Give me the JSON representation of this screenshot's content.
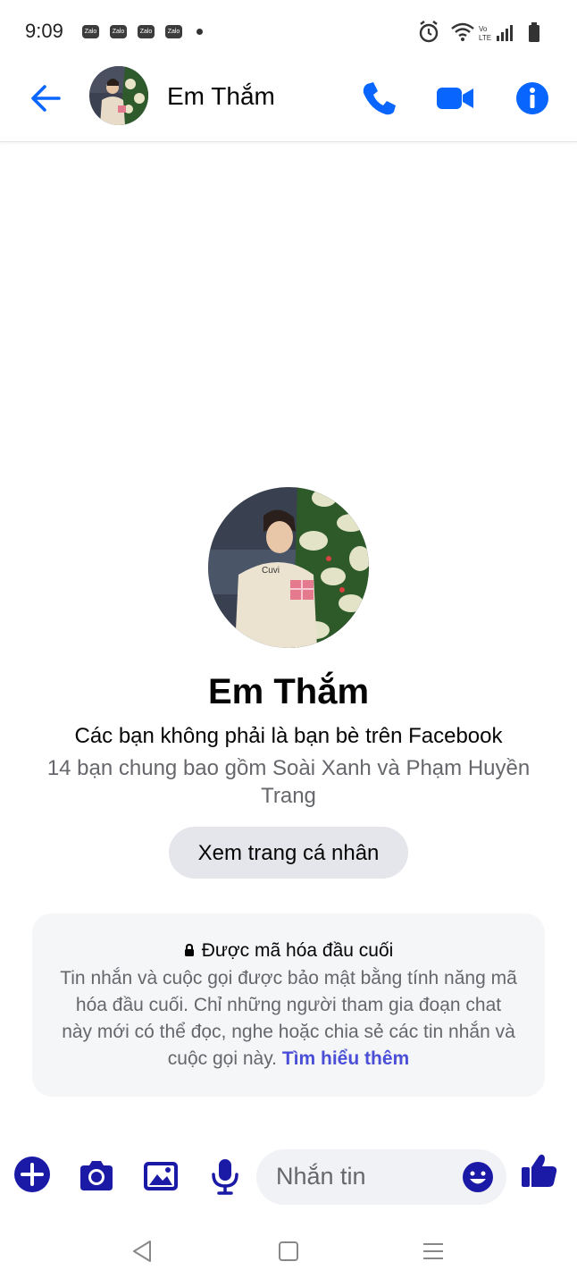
{
  "status": {
    "time": "9:09",
    "notification_apps": [
      "Zalo",
      "Zalo",
      "Zalo",
      "Zalo"
    ],
    "network": "Vo LTE"
  },
  "header": {
    "contact_name": "Em Thắm"
  },
  "profile": {
    "name": "Em Thắm",
    "friend_status": "Các bạn không phải là bạn bè trên Facebook",
    "mutual_friends": "14 bạn chung bao gồm Soài Xanh và Phạm Huyền Trang",
    "view_profile_label": "Xem trang cá nhân"
  },
  "encryption": {
    "title": "Được mã hóa đầu cuối",
    "body": "Tin nhắn và cuộc gọi được bảo mật bằng tính năng mã hóa đầu cuối. Chỉ những người tham gia đoạn chat này mới có thể đọc, nghe hoặc chia sẻ các tin nhắn và cuộc gọi này.",
    "link": "Tìm hiểu thêm"
  },
  "composer": {
    "placeholder": "Nhắn tin"
  },
  "colors": {
    "accent": "#0866ff",
    "composer_accent": "#1a1aa6",
    "link": "#4b4fd8"
  },
  "icons": {
    "header": [
      "back-arrow-icon",
      "phone-icon",
      "video-camera-icon",
      "info-icon"
    ],
    "composer": [
      "plus-icon",
      "camera-icon",
      "image-icon",
      "microphone-icon",
      "emoji-icon",
      "thumbs-up-icon"
    ],
    "navbar": [
      "nav-back-icon",
      "nav-home-icon",
      "nav-menu-icon"
    ]
  }
}
